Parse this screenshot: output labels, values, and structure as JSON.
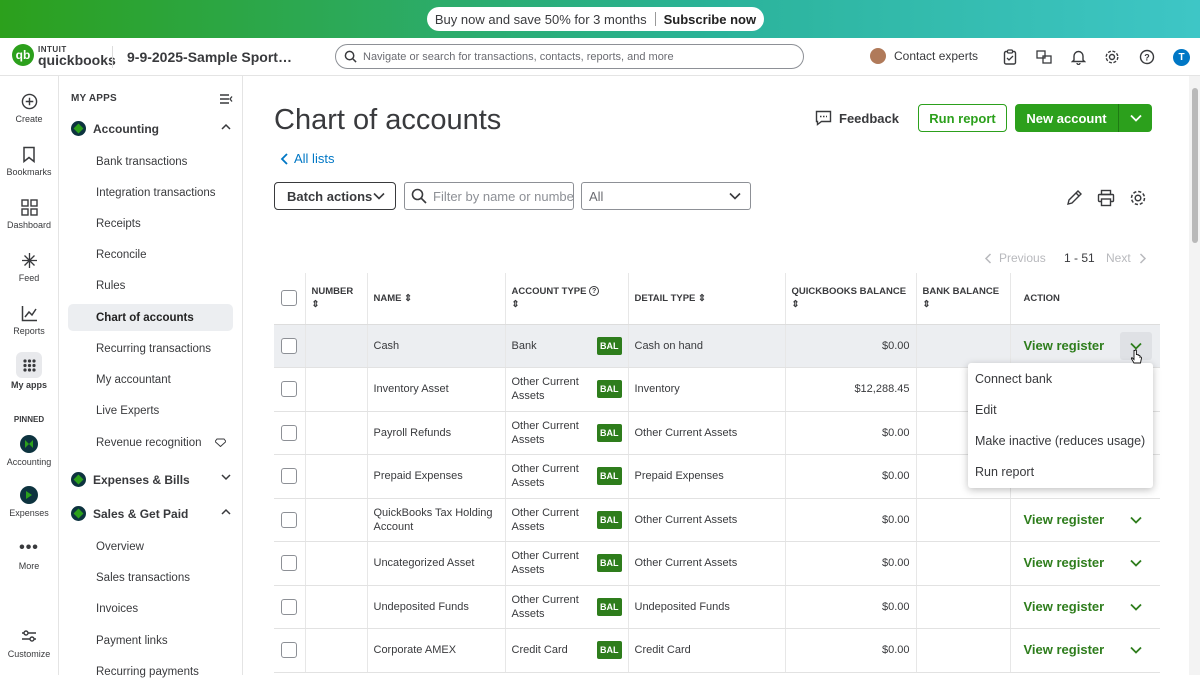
{
  "promo": {
    "text": "Buy now and save 50% for 3 months",
    "cta": "Subscribe now"
  },
  "header": {
    "logo_top": "INTUIT",
    "logo_bottom": "quickbooks",
    "company": "9-9-2025-Sample Sport…",
    "search_placeholder": "Navigate or search for transactions, contacts, reports, and more",
    "contact": "Contact experts",
    "avatar_initial": "T"
  },
  "rail": {
    "create": "Create",
    "bookmarks": "Bookmarks",
    "dashboard": "Dashboard",
    "feed": "Feed",
    "reports": "Reports",
    "myapps": "My apps",
    "pinned": "PINNED",
    "accounting": "Accounting",
    "expenses": "Expenses",
    "more": "More",
    "customize": "Customize"
  },
  "nav": {
    "heading": "MY APPS",
    "accounting": "Accounting",
    "items": [
      "Bank transactions",
      "Integration transactions",
      "Receipts",
      "Reconcile",
      "Rules",
      "Chart of accounts",
      "Recurring transactions",
      "My accountant",
      "Live Experts",
      "Revenue recognition"
    ],
    "expenses": "Expenses & Bills",
    "sales": "Sales & Get Paid",
    "sales_items": [
      "Overview",
      "Sales transactions",
      "Invoices",
      "Payment links",
      "Recurring payments"
    ]
  },
  "page": {
    "title": "Chart of accounts",
    "all_lists": "All lists",
    "feedback": "Feedback",
    "run_report": "Run report",
    "new_account": "New account",
    "batch_actions": "Batch actions",
    "filter_placeholder": "Filter by name or number",
    "type_select": "All",
    "pager_prev": "Previous",
    "pager_range": "1 - 51",
    "pager_next": "Next"
  },
  "table": {
    "headers": {
      "number": "NUMBER",
      "name": "NAME",
      "account_type": "ACCOUNT TYPE",
      "detail_type": "DETAIL TYPE",
      "qb_balance": "QUICKBOOKS BALANCE",
      "bank_balance": "BANK BALANCE",
      "action": "ACTION"
    },
    "bal_badge": "BAL",
    "view_register": "View register",
    "rows": [
      {
        "number": "",
        "name": "Cash",
        "type": "Bank",
        "detail": "Cash on hand",
        "balance": "$0.00",
        "bank": ""
      },
      {
        "number": "",
        "name": "Inventory Asset",
        "type": "Other Current Assets",
        "detail": "Inventory",
        "balance": "$12,288.45",
        "bank": ""
      },
      {
        "number": "",
        "name": "Payroll Refunds",
        "type": "Other Current Assets",
        "detail": "Other Current Assets",
        "balance": "$0.00",
        "bank": ""
      },
      {
        "number": "",
        "name": "Prepaid Expenses",
        "type": "Other Current Assets",
        "detail": "Prepaid Expenses",
        "balance": "$0.00",
        "bank": ""
      },
      {
        "number": "",
        "name": "QuickBooks Tax Holding Account",
        "type": "Other Current Assets",
        "detail": "Other Current Assets",
        "balance": "$0.00",
        "bank": ""
      },
      {
        "number": "",
        "name": "Uncategorized Asset",
        "type": "Other Current Assets",
        "detail": "Other Current Assets",
        "balance": "$0.00",
        "bank": ""
      },
      {
        "number": "",
        "name": "Undeposited Funds",
        "type": "Other Current Assets",
        "detail": "Undeposited Funds",
        "balance": "$0.00",
        "bank": ""
      },
      {
        "number": "",
        "name": "Corporate AMEX",
        "type": "Credit Card",
        "detail": "Credit Card",
        "balance": "$0.00",
        "bank": ""
      }
    ]
  },
  "dropdown_menu": [
    "Connect bank",
    "Edit",
    "Make inactive (reduces usage)",
    "Run report"
  ],
  "colors": {
    "brand_green": "#2ca01c",
    "link_blue": "#0077c5",
    "dark_text": "#393a3d"
  }
}
